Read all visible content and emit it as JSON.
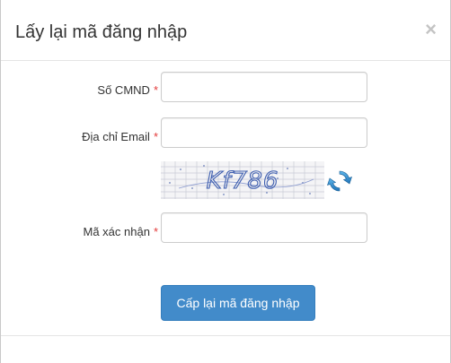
{
  "dialog": {
    "title": "Lấy lại mã đăng nhập",
    "close_label": "×"
  },
  "form": {
    "cmnd_label": "Số CMND",
    "email_label": "Địa chỉ Email",
    "captcha_label": "Mã xác nhận",
    "required_mark": "*",
    "cmnd_value": "",
    "email_value": "",
    "captcha_value": "",
    "captcha_text": "Kf786",
    "refresh_icon": "refresh-icon",
    "submit_label": "Cấp lại mã đăng nhập"
  },
  "colors": {
    "accent": "#428bca",
    "required": "#e33b3b"
  }
}
